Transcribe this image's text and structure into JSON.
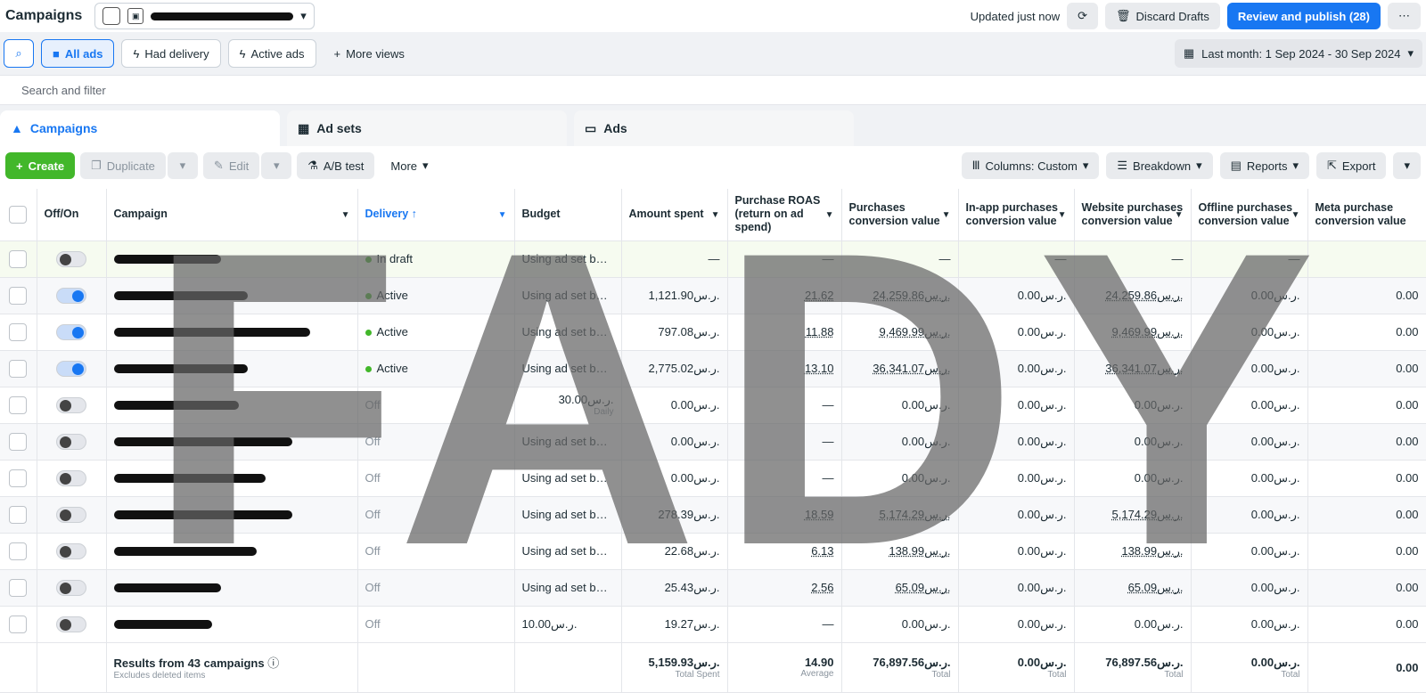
{
  "top": {
    "title": "Campaigns",
    "updated": "Updated just now",
    "discard": "Discard Drafts",
    "publish": "Review and publish (28)"
  },
  "views": {
    "all": "All ads",
    "had": "Had delivery",
    "active": "Active ads",
    "more": "More views",
    "date": "Last month: 1 Sep 2024 - 30 Sep 2024"
  },
  "filter": {
    "placeholder": "Search and filter"
  },
  "tabs": [
    "Campaigns",
    "Ad sets",
    "Ads"
  ],
  "toolbar": {
    "create": "Create",
    "duplicate": "Duplicate",
    "edit": "Edit",
    "ab": "A/B test",
    "more": "More",
    "columns": "Columns: Custom",
    "breakdown": "Breakdown",
    "reports": "Reports",
    "export": "Export"
  },
  "headers": [
    "Off/On",
    "Campaign",
    "Delivery ↑",
    "Budget",
    "Amount spent",
    "Purchase ROAS (return on ad spend)",
    "Purchases conversion value",
    "In-app purchases conversion value",
    "Website purchases conversion value",
    "Offline purchases conversion value",
    "Meta purchase conversion value"
  ],
  "rows": [
    {
      "on": false,
      "delivery": "In draft",
      "dot": true,
      "budget": "Using ad set bud...",
      "spent": "—",
      "roas": "—",
      "pcv": "—",
      "inapp": "—",
      "web": "—",
      "off": "—",
      "meta": ""
    },
    {
      "on": true,
      "delivery": "Active",
      "dot": true,
      "budget": "Using ad set bud...",
      "spent": "1,121.90ر.س.",
      "roas": "21.62",
      "pcv": "24,259.86ر.س.",
      "inapp": "0.00ر.س.",
      "web": "24,259.86ر.س.",
      "off": "0.00ر.س.",
      "meta": "0.00"
    },
    {
      "on": true,
      "delivery": "Active",
      "dot": true,
      "budget": "Using ad set bud...",
      "spent": "797.08ر.س.",
      "roas": "11.88",
      "pcv": "9,469.99ر.س.",
      "inapp": "0.00ر.س.",
      "web": "9,469.99ر.س.",
      "off": "0.00ر.س.",
      "meta": "0.00"
    },
    {
      "on": true,
      "delivery": "Active",
      "dot": true,
      "budget": "Using ad set bud...",
      "spent": "2,775.02ر.س.",
      "roas": "13.10",
      "pcv": "36,341.07ر.س.",
      "inapp": "0.00ر.س.",
      "web": "36,341.07ر.س.",
      "off": "0.00ر.س.",
      "meta": "0.00"
    },
    {
      "on": false,
      "delivery": "Off",
      "dot": false,
      "budget": "30.00ر.س.",
      "budget_sub": "Daily",
      "spent": "0.00ر.س.",
      "roas": "—",
      "pcv": "0.00ر.س.",
      "inapp": "0.00ر.س.",
      "web": "0.00ر.س.",
      "off": "0.00ر.س.",
      "meta": "0.00"
    },
    {
      "on": false,
      "delivery": "Off",
      "dot": false,
      "budget": "Using ad set bud...",
      "spent": "0.00ر.س.",
      "roas": "—",
      "pcv": "0.00ر.س.",
      "inapp": "0.00ر.س.",
      "web": "0.00ر.س.",
      "off": "0.00ر.س.",
      "meta": "0.00"
    },
    {
      "on": false,
      "delivery": "Off",
      "dot": false,
      "budget": "Using ad set bud...",
      "spent": "0.00ر.س.",
      "roas": "—",
      "pcv": "0.00ر.س.",
      "inapp": "0.00ر.س.",
      "web": "0.00ر.س.",
      "off": "0.00ر.س.",
      "meta": "0.00"
    },
    {
      "on": false,
      "delivery": "Off",
      "dot": false,
      "budget": "Using ad set bud...",
      "spent": "278.39ر.س.",
      "roas": "18.59",
      "pcv": "5,174.29ر.س.",
      "inapp": "0.00ر.س.",
      "web": "5,174.29ر.س.",
      "off": "0.00ر.س.",
      "meta": "0.00"
    },
    {
      "on": false,
      "delivery": "Off",
      "dot": false,
      "budget": "Using ad set bud...",
      "spent": "22.68ر.س.",
      "roas": "6.13",
      "pcv": "138.99ر.س.",
      "inapp": "0.00ر.س.",
      "web": "138.99ر.س.",
      "off": "0.00ر.س.",
      "meta": "0.00"
    },
    {
      "on": false,
      "delivery": "Off",
      "dot": false,
      "budget": "Using ad set bud...",
      "spent": "25.43ر.س.",
      "roas": "2.56",
      "pcv": "65.09ر.س.",
      "inapp": "0.00ر.س.",
      "web": "65.09ر.س.",
      "off": "0.00ر.س.",
      "meta": "0.00"
    },
    {
      "on": false,
      "delivery": "Off",
      "dot": false,
      "budget": "10.00ر.س.",
      "spent": "19.27ر.س.",
      "roas": "—",
      "pcv": "0.00ر.س.",
      "inapp": "0.00ر.س.",
      "web": "0.00ر.س.",
      "off": "0.00ر.س.",
      "meta": "0.00"
    }
  ],
  "footer": {
    "label": "Results from 43 campaigns",
    "sub": "Excludes deleted items",
    "spent": "5,159.93ر.س.",
    "spent_sub": "Total Spent",
    "roas": "14.90",
    "roas_sub": "Average",
    "pcv": "76,897.56ر.س.",
    "pcv_sub": "Total",
    "inapp": "0.00ر.س.",
    "inapp_sub": "Total",
    "web": "76,897.56ر.س.",
    "web_sub": "Total",
    "off": "0.00ر.س.",
    "off_sub": "Total",
    "meta": "0.00"
  },
  "watermark": "FADY"
}
